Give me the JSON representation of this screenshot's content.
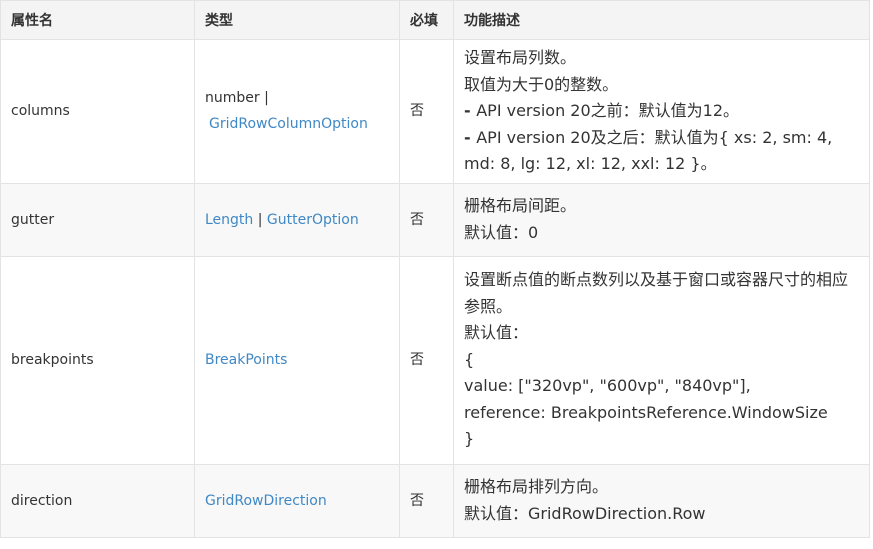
{
  "table": {
    "headers": {
      "name": "属性名",
      "type": "类型",
      "required": "必填",
      "description": "功能描述"
    },
    "rows": [
      {
        "name": "columns",
        "type_prefix": "number |",
        "type_links": [
          "GridRowColumnOption"
        ],
        "required": "否",
        "description": [
          "设置布局列数。",
          "取值为大于0的整数。",
          "API version 20之前：默认值为12。",
          "API version 20及之后：默认值为{ xs: 2, sm: 4, md: 8, lg: 12, xl: 12, xxl: 12 }。"
        ],
        "description_bullet": "- "
      },
      {
        "name": "gutter",
        "type_links": [
          "Length",
          "GutterOption"
        ],
        "type_separator": " | ",
        "required": "否",
        "description": [
          "栅格布局间距。",
          "默认值：0"
        ]
      },
      {
        "name": "breakpoints",
        "type_links": [
          "BreakPoints"
        ],
        "required": "否",
        "description": [
          "设置断点值的断点数列以及基于窗口或容器尺寸的相应参照。",
          "默认值：",
          "{",
          "value: [\"320vp\", \"600vp\", \"840vp\"],",
          "reference: BreakpointsReference.WindowSize",
          "}"
        ]
      },
      {
        "name": "direction",
        "type_links": [
          "GridRowDirection"
        ],
        "required": "否",
        "description": [
          "栅格布局排列方向。",
          "默认值：GridRowDirection.Row"
        ]
      }
    ]
  }
}
